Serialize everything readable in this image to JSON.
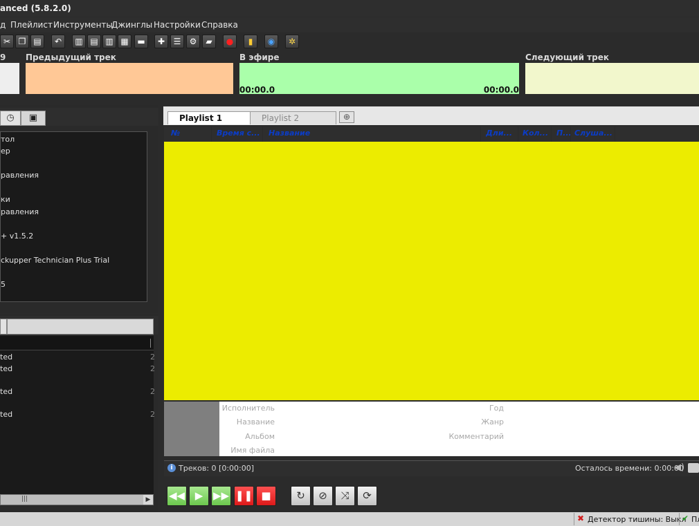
{
  "window": {
    "title": "anced (5.8.2.0)"
  },
  "menu": [
    "д",
    "Плейлист",
    "Инструменты",
    "Джинглы",
    "Настройки",
    "Справка"
  ],
  "toolbar": {
    "buttons": [
      "cut-icon",
      "copy-icon",
      "paste-icon",
      "undo-icon",
      "layout-1-icon",
      "layout-2-icon",
      "layout-3-icon",
      "layout-4-icon",
      "layout-5-icon",
      "add-track-icon",
      "add-list-icon",
      "settings-doc-icon",
      "open-folder-icon",
      "record-icon",
      "stats-icon",
      "globe-icon",
      "settings-icon"
    ]
  },
  "tracks": {
    "left_label": "9",
    "previous": {
      "label": "Предыдущий трек",
      "color": "#ffc896"
    },
    "on_air": {
      "label": "В эфире",
      "color": "#aaffaa",
      "time_start": "00:00.0",
      "time_end": "00:00.0"
    },
    "next": {
      "label": "Следующий трек",
      "color": "#f2f7cc"
    }
  },
  "left_top": {
    "items": [
      "тол",
      "ер",
      "равления",
      "ки",
      "равления",
      "+ v1.5.2",
      "ckupper Technician Plus Trial",
      "5"
    ]
  },
  "left_bottom": {
    "items": [
      "ted",
      "ted",
      "ted",
      "ted"
    ],
    "right_marks": [
      "2",
      "2",
      "2",
      "2"
    ],
    "scroll_grip": "|||"
  },
  "playlist": {
    "tabs": [
      "Playlist 1",
      "Playlist 2"
    ],
    "columns": [
      "№",
      "Время с...",
      "Название",
      "Дли...",
      "Кол...",
      "П...",
      "Слуша..."
    ],
    "bg_color": "#ecec00"
  },
  "info_fields": {
    "left": [
      "Исполнитель",
      "Название",
      "Альбом",
      "Имя файла"
    ],
    "right": [
      "Год",
      "Жанр",
      "Комментарий"
    ]
  },
  "footer": {
    "tracks": "Треков: 0 [0:00:00]",
    "remaining": "Осталось времени: 0:00:00"
  },
  "status": {
    "silence_detector": "Детектор тишины: Выкл",
    "right_partial": "Пл"
  }
}
